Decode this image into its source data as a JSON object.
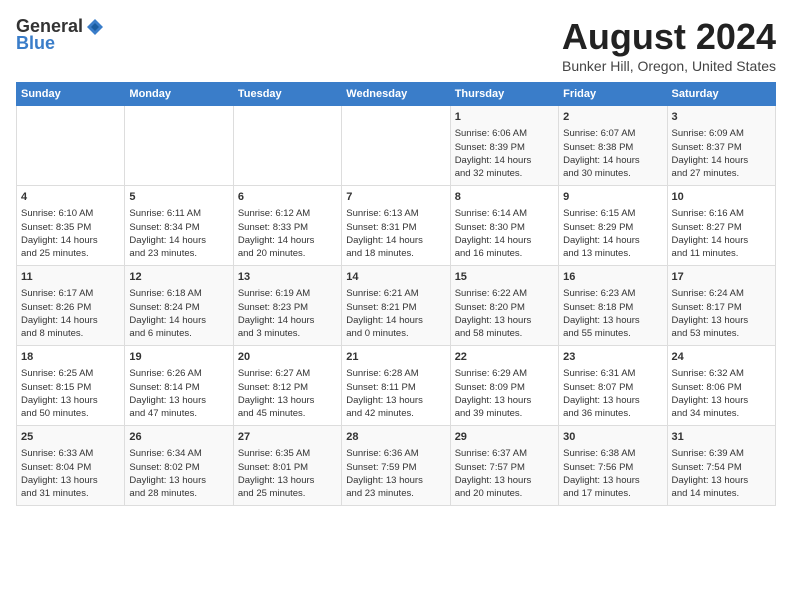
{
  "header": {
    "logo_general": "General",
    "logo_blue": "Blue",
    "title": "August 2024",
    "subtitle": "Bunker Hill, Oregon, United States"
  },
  "days_of_week": [
    "Sunday",
    "Monday",
    "Tuesday",
    "Wednesday",
    "Thursday",
    "Friday",
    "Saturday"
  ],
  "weeks": [
    {
      "days": [
        {
          "num": "",
          "content": ""
        },
        {
          "num": "",
          "content": ""
        },
        {
          "num": "",
          "content": ""
        },
        {
          "num": "",
          "content": ""
        },
        {
          "num": "1",
          "content": "Sunrise: 6:06 AM\nSunset: 8:39 PM\nDaylight: 14 hours\nand 32 minutes."
        },
        {
          "num": "2",
          "content": "Sunrise: 6:07 AM\nSunset: 8:38 PM\nDaylight: 14 hours\nand 30 minutes."
        },
        {
          "num": "3",
          "content": "Sunrise: 6:09 AM\nSunset: 8:37 PM\nDaylight: 14 hours\nand 27 minutes."
        }
      ]
    },
    {
      "days": [
        {
          "num": "4",
          "content": "Sunrise: 6:10 AM\nSunset: 8:35 PM\nDaylight: 14 hours\nand 25 minutes."
        },
        {
          "num": "5",
          "content": "Sunrise: 6:11 AM\nSunset: 8:34 PM\nDaylight: 14 hours\nand 23 minutes."
        },
        {
          "num": "6",
          "content": "Sunrise: 6:12 AM\nSunset: 8:33 PM\nDaylight: 14 hours\nand 20 minutes."
        },
        {
          "num": "7",
          "content": "Sunrise: 6:13 AM\nSunset: 8:31 PM\nDaylight: 14 hours\nand 18 minutes."
        },
        {
          "num": "8",
          "content": "Sunrise: 6:14 AM\nSunset: 8:30 PM\nDaylight: 14 hours\nand 16 minutes."
        },
        {
          "num": "9",
          "content": "Sunrise: 6:15 AM\nSunset: 8:29 PM\nDaylight: 14 hours\nand 13 minutes."
        },
        {
          "num": "10",
          "content": "Sunrise: 6:16 AM\nSunset: 8:27 PM\nDaylight: 14 hours\nand 11 minutes."
        }
      ]
    },
    {
      "days": [
        {
          "num": "11",
          "content": "Sunrise: 6:17 AM\nSunset: 8:26 PM\nDaylight: 14 hours\nand 8 minutes."
        },
        {
          "num": "12",
          "content": "Sunrise: 6:18 AM\nSunset: 8:24 PM\nDaylight: 14 hours\nand 6 minutes."
        },
        {
          "num": "13",
          "content": "Sunrise: 6:19 AM\nSunset: 8:23 PM\nDaylight: 14 hours\nand 3 minutes."
        },
        {
          "num": "14",
          "content": "Sunrise: 6:21 AM\nSunset: 8:21 PM\nDaylight: 14 hours\nand 0 minutes."
        },
        {
          "num": "15",
          "content": "Sunrise: 6:22 AM\nSunset: 8:20 PM\nDaylight: 13 hours\nand 58 minutes."
        },
        {
          "num": "16",
          "content": "Sunrise: 6:23 AM\nSunset: 8:18 PM\nDaylight: 13 hours\nand 55 minutes."
        },
        {
          "num": "17",
          "content": "Sunrise: 6:24 AM\nSunset: 8:17 PM\nDaylight: 13 hours\nand 53 minutes."
        }
      ]
    },
    {
      "days": [
        {
          "num": "18",
          "content": "Sunrise: 6:25 AM\nSunset: 8:15 PM\nDaylight: 13 hours\nand 50 minutes."
        },
        {
          "num": "19",
          "content": "Sunrise: 6:26 AM\nSunset: 8:14 PM\nDaylight: 13 hours\nand 47 minutes."
        },
        {
          "num": "20",
          "content": "Sunrise: 6:27 AM\nSunset: 8:12 PM\nDaylight: 13 hours\nand 45 minutes."
        },
        {
          "num": "21",
          "content": "Sunrise: 6:28 AM\nSunset: 8:11 PM\nDaylight: 13 hours\nand 42 minutes."
        },
        {
          "num": "22",
          "content": "Sunrise: 6:29 AM\nSunset: 8:09 PM\nDaylight: 13 hours\nand 39 minutes."
        },
        {
          "num": "23",
          "content": "Sunrise: 6:31 AM\nSunset: 8:07 PM\nDaylight: 13 hours\nand 36 minutes."
        },
        {
          "num": "24",
          "content": "Sunrise: 6:32 AM\nSunset: 8:06 PM\nDaylight: 13 hours\nand 34 minutes."
        }
      ]
    },
    {
      "days": [
        {
          "num": "25",
          "content": "Sunrise: 6:33 AM\nSunset: 8:04 PM\nDaylight: 13 hours\nand 31 minutes."
        },
        {
          "num": "26",
          "content": "Sunrise: 6:34 AM\nSunset: 8:02 PM\nDaylight: 13 hours\nand 28 minutes."
        },
        {
          "num": "27",
          "content": "Sunrise: 6:35 AM\nSunset: 8:01 PM\nDaylight: 13 hours\nand 25 minutes."
        },
        {
          "num": "28",
          "content": "Sunrise: 6:36 AM\nSunset: 7:59 PM\nDaylight: 13 hours\nand 23 minutes."
        },
        {
          "num": "29",
          "content": "Sunrise: 6:37 AM\nSunset: 7:57 PM\nDaylight: 13 hours\nand 20 minutes."
        },
        {
          "num": "30",
          "content": "Sunrise: 6:38 AM\nSunset: 7:56 PM\nDaylight: 13 hours\nand 17 minutes."
        },
        {
          "num": "31",
          "content": "Sunrise: 6:39 AM\nSunset: 7:54 PM\nDaylight: 13 hours\nand 14 minutes."
        }
      ]
    }
  ]
}
